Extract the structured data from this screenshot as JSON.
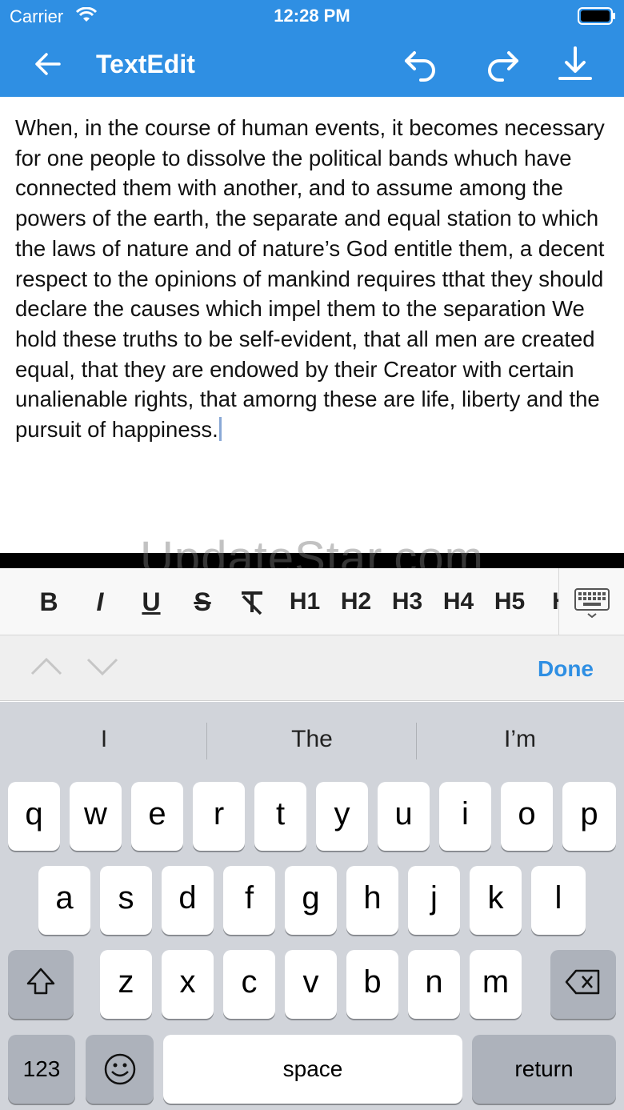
{
  "status": {
    "carrier": "Carrier",
    "time": "12:28 PM"
  },
  "nav": {
    "title": "TextEdit"
  },
  "editor": {
    "text": "When, in the course of human events, it becomes necessary for one people to dissolve the political bands whuch have connected them with another, and to assume among the powers of the earth, the separate and equal station to which the laws of nature and of nature’s God entitle them, a decent respect to the opinions of mankind requires tthat they should declare the causes which impel them to the separation We hold these truths to be self-evident, that all men are created equal, that they are endowed by their Creator with certain unalienable rights, that amorng these are life, liberty and the pursuit of happiness."
  },
  "watermark": "UpdateStar.com",
  "format_toolbar": {
    "bold": "B",
    "italic": "I",
    "underline": "U",
    "strike": "S",
    "h1": "H1",
    "h2": "H2",
    "h3": "H3",
    "h4": "H4",
    "h5": "H5",
    "h6": "H"
  },
  "accessory": {
    "done": "Done"
  },
  "keyboard": {
    "suggestions": [
      "I",
      "The",
      "I’m"
    ],
    "row1": [
      "q",
      "w",
      "e",
      "r",
      "t",
      "y",
      "u",
      "i",
      "o",
      "p"
    ],
    "row2": [
      "a",
      "s",
      "d",
      "f",
      "g",
      "h",
      "j",
      "k",
      "l"
    ],
    "row3": [
      "z",
      "x",
      "c",
      "v",
      "b",
      "n",
      "m"
    ],
    "numbers": "123",
    "space": "space",
    "return": "return"
  },
  "colors": {
    "accent": "#2F8FE3",
    "keyboard_bg": "#d1d4da"
  },
  "icons": [
    "wifi-icon",
    "battery-icon",
    "back-arrow-icon",
    "undo-icon",
    "redo-icon",
    "download-icon",
    "clear-format-icon",
    "keyboard-dismiss-icon",
    "chevron-up-icon",
    "chevron-down-icon",
    "shift-icon",
    "delete-icon",
    "emoji-icon"
  ]
}
